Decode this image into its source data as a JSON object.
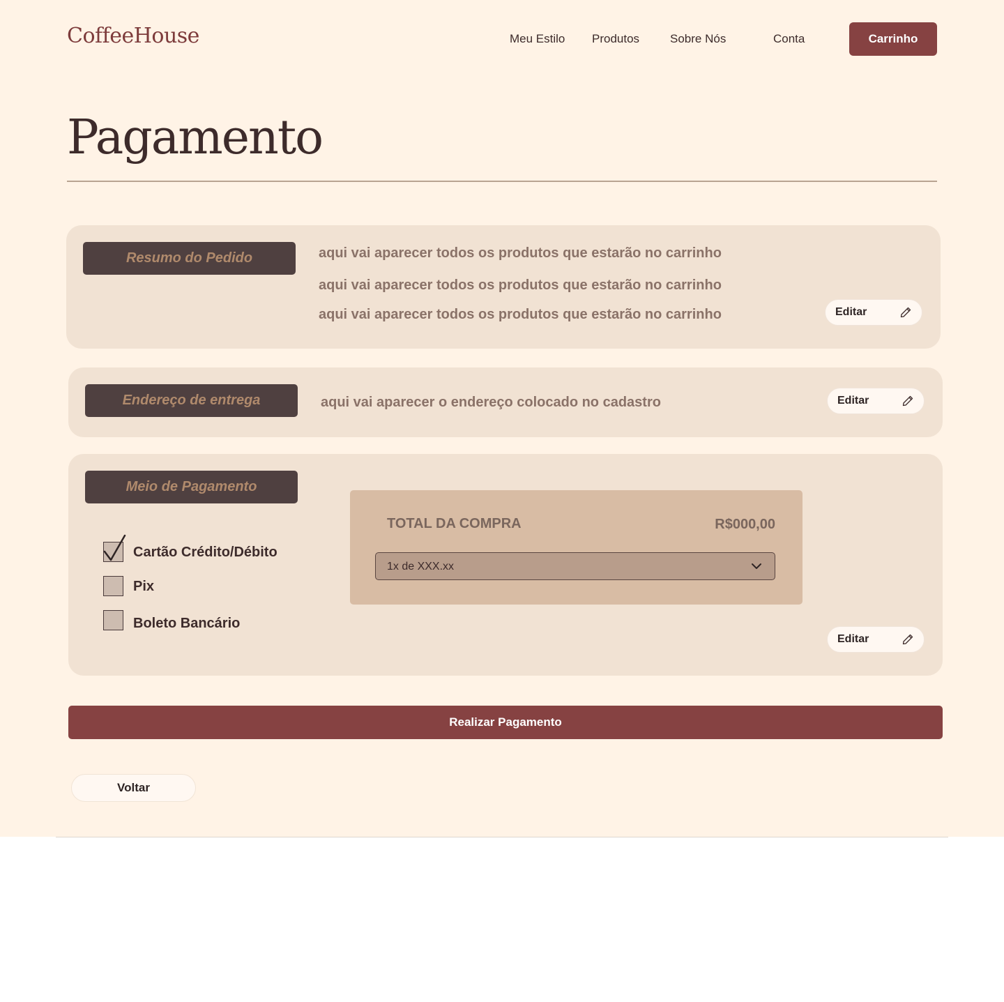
{
  "header": {
    "logo": "CoffeeHouse",
    "nav": [
      "Meu Estilo",
      "Produtos",
      "Sobre Nós",
      "Conta"
    ],
    "cart_label": "Carrinho"
  },
  "page_title": "Pagamento",
  "order_summary": {
    "label": "Resumo do Pedido",
    "lines": [
      "aqui vai aparecer todos os produtos que estarão no carrinho",
      "aqui vai aparecer todos os produtos que estarão no carrinho",
      "aqui vai aparecer todos os produtos que estarão no carrinho"
    ],
    "edit_label": "Editar"
  },
  "delivery_address": {
    "label": "Endereço de entrega",
    "text": "aqui vai aparecer o endereço colocado no cadastro",
    "edit_label": "Editar"
  },
  "payment_method": {
    "label": "Meio de Pagamento",
    "options": [
      {
        "label": "Cartão Crédito/Débito",
        "checked": true
      },
      {
        "label": "Pix",
        "checked": false
      },
      {
        "label": "Boleto Bancário",
        "checked": false
      }
    ],
    "total_label": "TOTAL DA COMPRA",
    "total_value": "R$000,00",
    "installments_value": "1x de XXX.xx",
    "edit_label": "Editar"
  },
  "actions": {
    "pay_label": "Realizar Pagamento",
    "back_label": "Voltar"
  },
  "colors": {
    "background": "#fff3e6",
    "accent": "#864242",
    "panel": "#f1e2d3",
    "label_bg": "#4f4040",
    "total_card": "#d8bca4"
  },
  "icons": {
    "edit": "pencil-icon",
    "dropdown": "chevron-down-icon",
    "checked": "checkmark-icon"
  }
}
